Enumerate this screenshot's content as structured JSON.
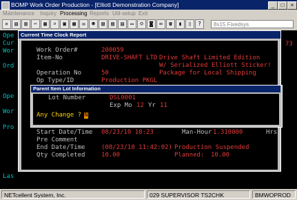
{
  "window": {
    "title": "BOMP Work Order Production - [Elliott Demonstration Company]"
  },
  "menu": [
    "Maintenance",
    "Inquiry",
    "Processing",
    "Reports",
    "Util-setup",
    "Exit"
  ],
  "toolbar": {
    "font_select": "8x15 Fixedsys"
  },
  "background_lines": [
    "Ope",
    "Cur",
    "Wor",
    "Ord",
    "Ope",
    "Wor",
    "Pro",
    "Las"
  ],
  "background_right": "73",
  "dialog": {
    "title": "Current Time Clock Report",
    "work_order_label": "Work Order#",
    "work_order_value": "200059",
    "item_label": "Item-No",
    "item_value": "DRIVE-SHAFT LTD",
    "item_desc_1": "Drive Shaft Limited Edition",
    "item_desc_2": "W/ Serialized Elliott Sticker!",
    "item_desc_3": "Package for Local Shipping",
    "operation_label": "Operation No",
    "operation_value": "50",
    "op_type_label": "Op Type/ID",
    "op_type_value": "Production PKGL",
    "start_label": "Start Date/Time",
    "start_value": "08/23/10 10:23",
    "man_hour_label": "Man-Hour",
    "man_hour_value": "1.310000",
    "hrs_label": "Hrs",
    "pre_comment_label": "Pre Comment",
    "end_label": "End Date/Time",
    "end_value": "(08/23/10 11:42:02)",
    "end_status": "Production Suspended",
    "qty_label": "Qty Completed",
    "qty_value": "10.00",
    "planned_label": "Planned:",
    "planned_value": "10.00"
  },
  "subdialog": {
    "title": "Parent Item Lot Information",
    "lot_label": "Lot Number",
    "lot_value": "DSL0001",
    "exp_label": "Exp Mo",
    "exp_mo": "12",
    "yr_label": "Yr",
    "exp_yr": "11",
    "any_change": "Any Change ?",
    "cursor_value": "N"
  },
  "statusbar": {
    "company": "NETcellent System, Inc.",
    "session": "029 SUPERVISOR TS2CHK",
    "program": "BMWOPROD"
  }
}
